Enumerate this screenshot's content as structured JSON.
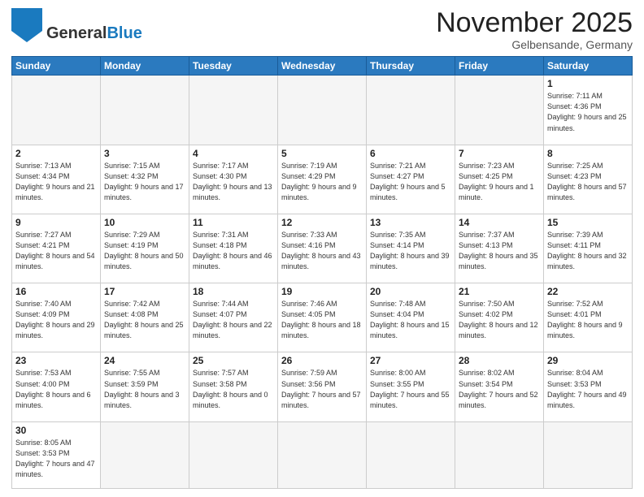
{
  "header": {
    "logo_general": "General",
    "logo_blue": "Blue",
    "month_title": "November 2025",
    "location": "Gelbensande, Germany"
  },
  "days_of_week": [
    "Sunday",
    "Monday",
    "Tuesday",
    "Wednesday",
    "Thursday",
    "Friday",
    "Saturday"
  ],
  "weeks": [
    [
      {
        "day": "",
        "empty": true
      },
      {
        "day": "",
        "empty": true
      },
      {
        "day": "",
        "empty": true
      },
      {
        "day": "",
        "empty": true
      },
      {
        "day": "",
        "empty": true
      },
      {
        "day": "",
        "empty": true
      },
      {
        "day": "1",
        "sunrise": "7:11 AM",
        "sunset": "4:36 PM",
        "daylight": "9 hours and 25 minutes."
      }
    ],
    [
      {
        "day": "2",
        "sunrise": "7:13 AM",
        "sunset": "4:34 PM",
        "daylight": "9 hours and 21 minutes."
      },
      {
        "day": "3",
        "sunrise": "7:15 AM",
        "sunset": "4:32 PM",
        "daylight": "9 hours and 17 minutes."
      },
      {
        "day": "4",
        "sunrise": "7:17 AM",
        "sunset": "4:30 PM",
        "daylight": "9 hours and 13 minutes."
      },
      {
        "day": "5",
        "sunrise": "7:19 AM",
        "sunset": "4:29 PM",
        "daylight": "9 hours and 9 minutes."
      },
      {
        "day": "6",
        "sunrise": "7:21 AM",
        "sunset": "4:27 PM",
        "daylight": "9 hours and 5 minutes."
      },
      {
        "day": "7",
        "sunrise": "7:23 AM",
        "sunset": "4:25 PM",
        "daylight": "9 hours and 1 minute."
      },
      {
        "day": "8",
        "sunrise": "7:25 AM",
        "sunset": "4:23 PM",
        "daylight": "8 hours and 57 minutes."
      }
    ],
    [
      {
        "day": "9",
        "sunrise": "7:27 AM",
        "sunset": "4:21 PM",
        "daylight": "8 hours and 54 minutes."
      },
      {
        "day": "10",
        "sunrise": "7:29 AM",
        "sunset": "4:19 PM",
        "daylight": "8 hours and 50 minutes."
      },
      {
        "day": "11",
        "sunrise": "7:31 AM",
        "sunset": "4:18 PM",
        "daylight": "8 hours and 46 minutes."
      },
      {
        "day": "12",
        "sunrise": "7:33 AM",
        "sunset": "4:16 PM",
        "daylight": "8 hours and 43 minutes."
      },
      {
        "day": "13",
        "sunrise": "7:35 AM",
        "sunset": "4:14 PM",
        "daylight": "8 hours and 39 minutes."
      },
      {
        "day": "14",
        "sunrise": "7:37 AM",
        "sunset": "4:13 PM",
        "daylight": "8 hours and 35 minutes."
      },
      {
        "day": "15",
        "sunrise": "7:39 AM",
        "sunset": "4:11 PM",
        "daylight": "8 hours and 32 minutes."
      }
    ],
    [
      {
        "day": "16",
        "sunrise": "7:40 AM",
        "sunset": "4:09 PM",
        "daylight": "8 hours and 29 minutes."
      },
      {
        "day": "17",
        "sunrise": "7:42 AM",
        "sunset": "4:08 PM",
        "daylight": "8 hours and 25 minutes."
      },
      {
        "day": "18",
        "sunrise": "7:44 AM",
        "sunset": "4:07 PM",
        "daylight": "8 hours and 22 minutes."
      },
      {
        "day": "19",
        "sunrise": "7:46 AM",
        "sunset": "4:05 PM",
        "daylight": "8 hours and 18 minutes."
      },
      {
        "day": "20",
        "sunrise": "7:48 AM",
        "sunset": "4:04 PM",
        "daylight": "8 hours and 15 minutes."
      },
      {
        "day": "21",
        "sunrise": "7:50 AM",
        "sunset": "4:02 PM",
        "daylight": "8 hours and 12 minutes."
      },
      {
        "day": "22",
        "sunrise": "7:52 AM",
        "sunset": "4:01 PM",
        "daylight": "8 hours and 9 minutes."
      }
    ],
    [
      {
        "day": "23",
        "sunrise": "7:53 AM",
        "sunset": "4:00 PM",
        "daylight": "8 hours and 6 minutes."
      },
      {
        "day": "24",
        "sunrise": "7:55 AM",
        "sunset": "3:59 PM",
        "daylight": "8 hours and 3 minutes."
      },
      {
        "day": "25",
        "sunrise": "7:57 AM",
        "sunset": "3:58 PM",
        "daylight": "8 hours and 0 minutes."
      },
      {
        "day": "26",
        "sunrise": "7:59 AM",
        "sunset": "3:56 PM",
        "daylight": "7 hours and 57 minutes."
      },
      {
        "day": "27",
        "sunrise": "8:00 AM",
        "sunset": "3:55 PM",
        "daylight": "7 hours and 55 minutes."
      },
      {
        "day": "28",
        "sunrise": "8:02 AM",
        "sunset": "3:54 PM",
        "daylight": "7 hours and 52 minutes."
      },
      {
        "day": "29",
        "sunrise": "8:04 AM",
        "sunset": "3:53 PM",
        "daylight": "7 hours and 49 minutes."
      }
    ],
    [
      {
        "day": "30",
        "sunrise": "8:05 AM",
        "sunset": "3:53 PM",
        "daylight": "7 hours and 47 minutes."
      },
      {
        "day": "",
        "empty": true
      },
      {
        "day": "",
        "empty": true
      },
      {
        "day": "",
        "empty": true
      },
      {
        "day": "",
        "empty": true
      },
      {
        "day": "",
        "empty": true
      },
      {
        "day": "",
        "empty": true
      }
    ]
  ]
}
